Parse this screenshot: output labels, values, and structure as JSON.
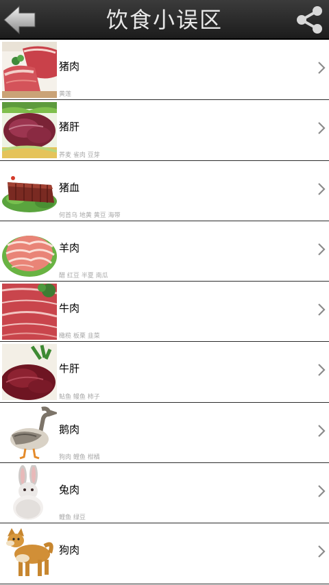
{
  "header": {
    "title": "饮食小误区",
    "back_icon": "back-arrow-icon",
    "share_icon": "share-icon"
  },
  "items": [
    {
      "name": "猪肉",
      "sub": "黄莲",
      "thumb": "pork"
    },
    {
      "name": "猪肝",
      "sub": "荞麦 雀肉 豆芽",
      "thumb": "pork-liver"
    },
    {
      "name": "猪血",
      "sub": "何首乌 地黄 黄豆 海带",
      "thumb": "pig-blood"
    },
    {
      "name": "羊肉",
      "sub": "醋 红豆 半夏 南瓜",
      "thumb": "mutton"
    },
    {
      "name": "牛肉",
      "sub": "橄榄 板栗 韭菜",
      "thumb": "beef"
    },
    {
      "name": "牛肝",
      "sub": "鲇鱼 鳗鱼 柿子",
      "thumb": "beef-liver"
    },
    {
      "name": "鹅肉",
      "sub": "狗肉 鲤鱼 柑橘",
      "thumb": "goose"
    },
    {
      "name": "兔肉",
      "sub": "鲤鱼 绿豆",
      "thumb": "rabbit"
    },
    {
      "name": "狗肉",
      "sub": "",
      "thumb": "dog"
    }
  ],
  "colors": {
    "header_bg": "#2a2a2a",
    "title_text": "#e8e8e8",
    "divider": "#2a2a2a",
    "sub_text": "#a8a8a8",
    "chevron": "#8c8c8c"
  }
}
